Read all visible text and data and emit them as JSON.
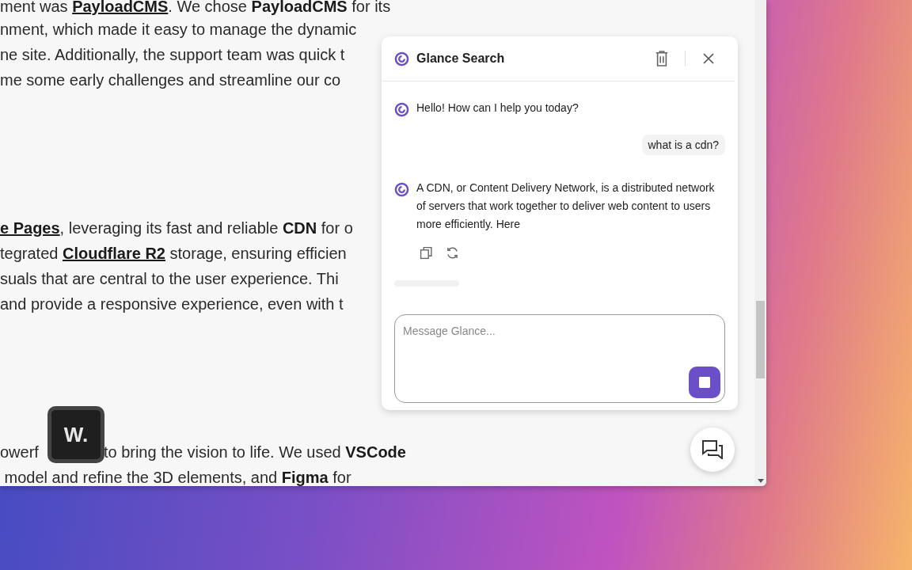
{
  "article": {
    "paragraphs": [
      {
        "lines": [
          {
            "parts": [
              [
                {
                  "kind": "plain",
                  "text": "ment was "
                },
                {
                  "kind": "link",
                  "text": "PayloadCMS"
                },
                {
                  "kind": "plain",
                  "text": ". We chose "
                },
                {
                  "kind": "bold",
                  "text": "PayloadCMS"
                },
                {
                  "kind": "plain",
                  "text": " for its"
                }
              ]
            ]
          },
          {
            "parts": [
              [
                {
                  "kind": "plain",
                  "text": "nment, which made it easy to manage the dynamic"
                }
              ]
            ]
          },
          {
            "parts": [
              [
                {
                  "kind": "plain",
                  "text": "ne site. Additionally, the support team was quick t"
                }
              ]
            ]
          },
          {
            "parts": [
              [
                {
                  "kind": "plain",
                  "text": "me some early challenges and streamline our co"
                }
              ]
            ]
          }
        ]
      },
      {
        "lines": [
          {
            "parts": [
              [
                {
                  "kind": "link",
                  "text": "e Pages"
                },
                {
                  "kind": "plain",
                  "text": ", leveraging its fast and reliable "
                },
                {
                  "kind": "bold",
                  "text": "CDN"
                },
                {
                  "kind": "plain",
                  "text": " for o"
                }
              ]
            ]
          },
          {
            "parts": [
              [
                {
                  "kind": "plain",
                  "text": "tegrated "
                },
                {
                  "kind": "link",
                  "text": "Cloudflare R2"
                },
                {
                  "kind": "plain",
                  "text": " storage, ensuring efficien"
                }
              ]
            ]
          },
          {
            "parts": [
              [
                {
                  "kind": "plain",
                  "text": "suals that are central to the user experience. Thi"
                }
              ]
            ]
          },
          {
            "parts": [
              [
                {
                  "kind": "plain",
                  "text": "and provide a responsive experience, even with t"
                }
              ]
            ]
          }
        ]
      },
      {
        "lines": [
          {
            "parts": [
              [
                {
                  "kind": "plain",
                  "text": "owerf"
                }
              ],
              [
                {
                  "kind": "plain",
                  "text": "to bring the vision to life. We used "
                },
                {
                  "kind": "bold",
                  "text": "VSCode"
                }
              ]
            ]
          },
          {
            "parts": [
              [
                {
                  "kind": "plain",
                  "text": " model and refine the 3D elements, and "
                },
                {
                  "kind": "bold",
                  "text": "Figma"
                },
                {
                  "kind": "plain",
                  "text": " for"
                }
              ]
            ]
          }
        ]
      }
    ]
  },
  "key_badge": {
    "text": "W."
  },
  "chat": {
    "title": "Glance Search",
    "messages": [
      {
        "kind": "bot",
        "text": "Hello! How can I help you today?",
        "actions": false
      },
      {
        "kind": "user",
        "text": "what is a cdn?"
      },
      {
        "kind": "bot",
        "text": "A CDN, or Content Delivery Network, is a distributed network of servers that work together to deliver web content to users more efficiently. Here",
        "actions": true
      }
    ],
    "loading": true,
    "input": {
      "placeholder": "Message Glance...",
      "generating": true
    }
  }
}
